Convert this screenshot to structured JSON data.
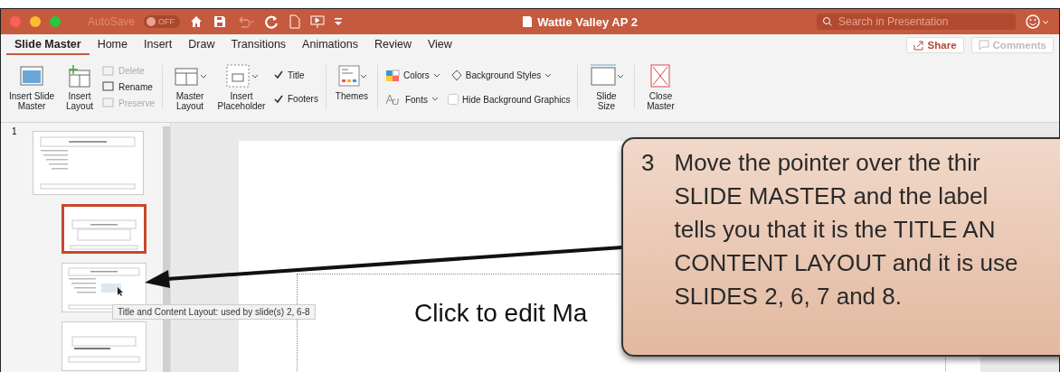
{
  "window": {
    "title": "Wattle Valley AP 2",
    "autosave_label": "AutoSave",
    "autosave": {
      "on": false,
      "label": "OFF"
    },
    "search": {
      "placeholder": "Search in Presentation"
    }
  },
  "tabs": [
    {
      "label": "Slide Master",
      "selected": true
    },
    {
      "label": "Home",
      "selected": false
    },
    {
      "label": "Insert",
      "selected": false
    },
    {
      "label": "Draw",
      "selected": false
    },
    {
      "label": "Transitions",
      "selected": false
    },
    {
      "label": "Animations",
      "selected": false
    },
    {
      "label": "Review",
      "selected": false
    },
    {
      "label": "View",
      "selected": false
    }
  ],
  "actions": [
    {
      "label": "Share",
      "disabled": false
    },
    {
      "label": "Comments",
      "disabled": true
    }
  ],
  "ribbon": {
    "insert_slide_master": "Insert Slide Master",
    "insert_layout": "Insert Layout",
    "small_buttons": [
      {
        "label": "Delete",
        "disabled": true
      },
      {
        "label": "Rename",
        "disabled": false
      },
      {
        "label": "Preserve",
        "disabled": true
      }
    ],
    "master_layout": "Master Layout",
    "insert_placeholder": "Insert Placeholder",
    "checks": [
      {
        "label": "Title",
        "checked": true
      },
      {
        "label": "Footers",
        "checked": true
      }
    ],
    "themes": "Themes",
    "colors": "Colors",
    "background_styles": "Background Styles",
    "fonts": "Fonts",
    "hide_background": {
      "label": "Hide Background Graphics",
      "checked": false
    },
    "slide_size": "Slide Size",
    "close_master": "Close Master"
  },
  "thumbnails": {
    "number": "1",
    "items": [
      {
        "kind": "master",
        "selected": false
      },
      {
        "kind": "title",
        "selected": true
      },
      {
        "kind": "content",
        "selected": false
      },
      {
        "kind": "header",
        "selected": false
      }
    ]
  },
  "tooltip": "Title and Content Layout: used by slide(s) 2, 6-8",
  "slide": {
    "title": "Click to edit Ma"
  },
  "callout": {
    "number": "3",
    "lines": [
      "Move the pointer over the thir",
      "SLIDE MASTER and the label",
      "tells you that it is the TITLE AN",
      "CONTENT LAYOUT and it is use",
      "SLIDES 2, 6, 7 and 8."
    ]
  }
}
